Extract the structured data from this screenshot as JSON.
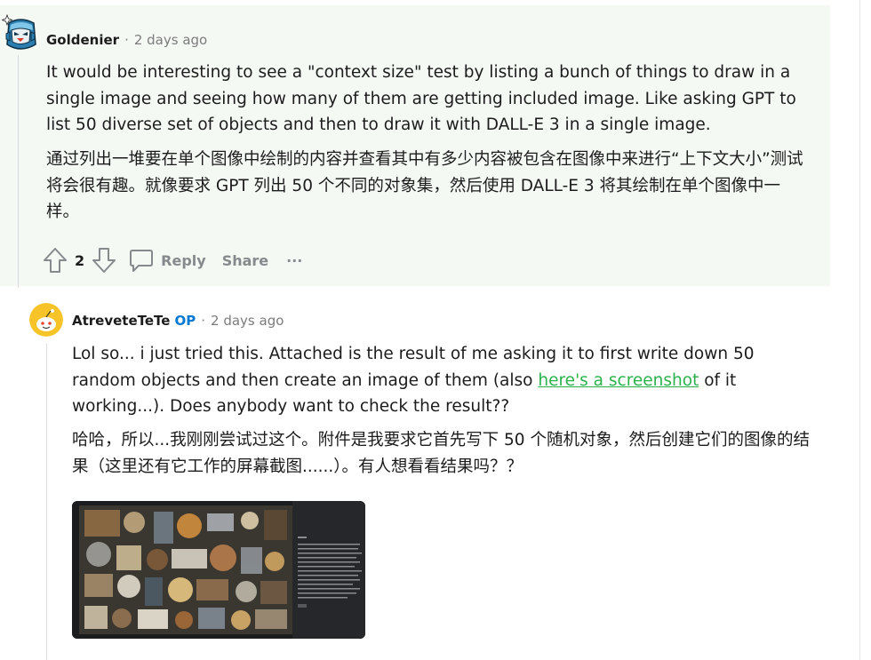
{
  "comments": [
    {
      "author": "Goldenier",
      "op_badge": "",
      "time": "2 days ago",
      "body_en": "It would be interesting to see a \"context size\" test by listing a bunch of things to draw in a single image and seeing how many of them are getting included image. Like asking GPT to list 50 diverse set of objects and then to draw it with DALL-E 3 in a single image.",
      "body_zh": "通过列出一堆要在单个图像中绘制的内容并查看其中有多少内容被包含在图像中来进行“上下文大小”测试将会很有趣。就像要求 GPT 列出 50 个不同的对象集，然后使用 DALL-E 3 将其绘制在单个图像中一样。",
      "votes": "2",
      "actions": {
        "reply": "Reply",
        "share": "Share",
        "more": "···"
      }
    },
    {
      "author": "AtreveteTeTe",
      "op_badge": "OP",
      "time": "2 days ago",
      "body_en_before_link": "Lol so... i just tried this. Attached is the result of me asking it to first write down 50 random objects and then create an image of them (also ",
      "body_en_link": "here's a screenshot",
      "body_en_after_link": " of it working...). Does anybody want to check the result??",
      "body_zh": "哈哈，所以...我刚刚尝试过这个。附件是我要求它首先写下 50 个随机对象，然后创建它们的图像的结果（这里还有它工作的屏幕截图......）。有人想看看结果吗？？"
    }
  ],
  "colors": {
    "highlight_bg": "#f4f9f4",
    "link": "#2bb24c",
    "op_badge": "#0079d3",
    "muted": "#7c7c7c"
  },
  "icons": {
    "upvote": "upvote-arrow-icon",
    "downvote": "downvote-arrow-icon",
    "reply": "speech-bubble-icon",
    "more": "ellipsis-icon"
  }
}
